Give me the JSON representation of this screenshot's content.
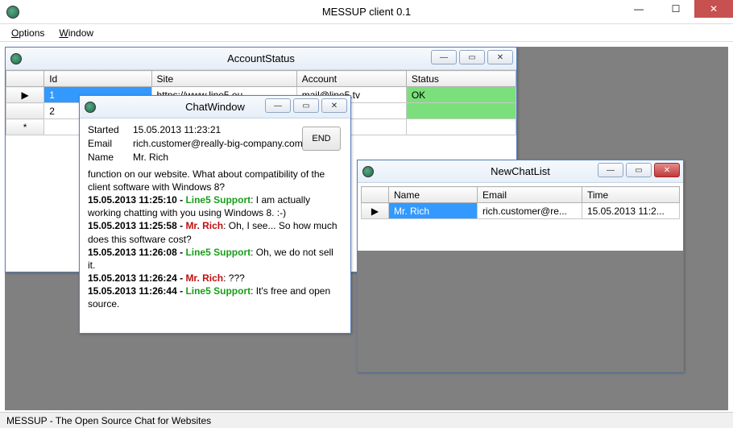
{
  "app": {
    "title": "MESSUP client 0.1",
    "menu": {
      "options": "Options",
      "window": "Window"
    },
    "statusbar": "MESSUP - The Open Source Chat for Websites"
  },
  "accountStatus": {
    "title": "AccountStatus",
    "cols": {
      "id": "Id",
      "site": "Site",
      "account": "Account",
      "status": "Status"
    },
    "rows": [
      {
        "marker": "▶",
        "id": "1",
        "site": "https://www.line5.eu...",
        "account": "mail@line5.tv",
        "status": "OK"
      },
      {
        "marker": "",
        "id": "2",
        "site": "",
        "account": "",
        "status": ""
      },
      {
        "marker": "*",
        "id": "",
        "site": "",
        "account": "",
        "status": ""
      }
    ]
  },
  "chatWindow": {
    "title": "ChatWindow",
    "endBtn": "END",
    "info": {
      "startedLabel": "Started",
      "startedValue": "15.05.2013 11:23:21",
      "emailLabel": "Email",
      "emailValue": "rich.customer@really-big-company.com",
      "nameLabel": "Name",
      "nameValue": "Mr. Rich"
    },
    "log": {
      "l0": "function on our website. What about compatibility of the client software with Windows 8?",
      "l1ts": "15.05.2013 11:25:10 - ",
      "l1who": "Line5 Support",
      "l1txt": ": I am actually working chatting with you using Windows 8. :-)",
      "l2ts": "15.05.2013 11:25:58 - ",
      "l2who": "Mr. Rich",
      "l2txt": ": Oh, I see... So how much does this software cost?",
      "l3ts": "15.05.2013 11:26:08 - ",
      "l3who": "Line5 Support",
      "l3txt": ": Oh, we do not sell it.",
      "l4ts": "15.05.2013 11:26:24 - ",
      "l4who": "Mr. Rich",
      "l4txt": ": ???",
      "l5ts": "15.05.2013 11:26:44 - ",
      "l5who": "Line5 Support",
      "l5txt": ": It's free and open source."
    }
  },
  "newChatList": {
    "title": "NewChatList",
    "cols": {
      "name": "Name",
      "email": "Email",
      "time": "Time"
    },
    "row": {
      "marker": "▶",
      "name": "Mr. Rich",
      "email": "rich.customer@re...",
      "time": "15.05.2013 11:2..."
    }
  }
}
